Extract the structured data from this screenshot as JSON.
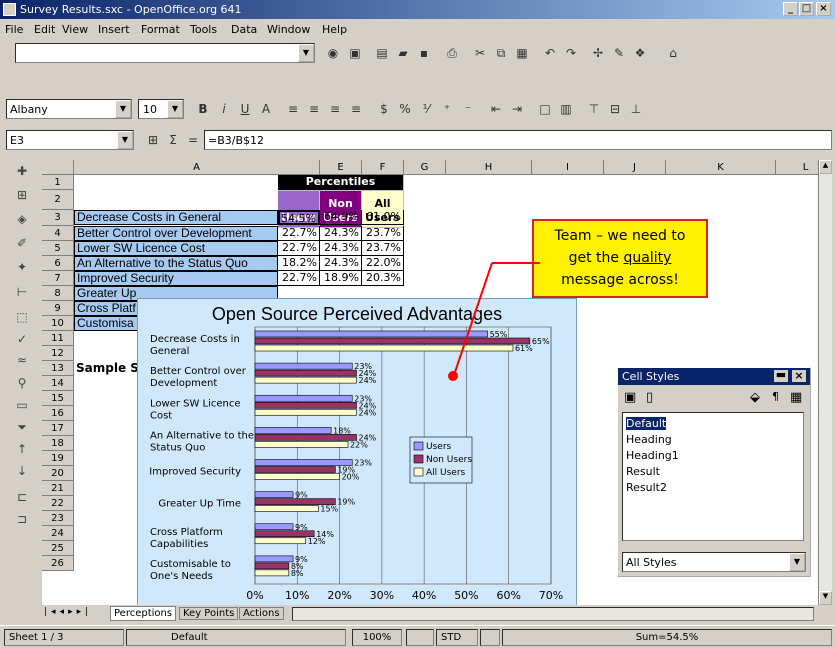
{
  "window": {
    "title": "Survey Results.sxc - OpenOffice.org 641"
  },
  "menu": [
    "File",
    "Edit",
    "View",
    "Insert",
    "Format",
    "Tools",
    "Data",
    "Window",
    "Help"
  ],
  "toolbar": {
    "font_name": "Albany",
    "font_size": "10",
    "cell_ref": "E3",
    "formula": "=B3/B$12",
    "sum_icon": "Σ",
    "equals": "="
  },
  "columns": [
    "A",
    "E",
    "F",
    "G",
    "H",
    "I",
    "J",
    "K",
    "L"
  ],
  "rows": [
    "1",
    "2",
    "3",
    "4",
    "5",
    "6",
    "7",
    "8",
    "9",
    "10",
    "11",
    "12",
    "13",
    "14",
    "15",
    "16",
    "17",
    "18",
    "19",
    "20",
    "21",
    "22",
    "23",
    "24",
    "25",
    "26"
  ],
  "sheet": {
    "percentiles_header": "Percentiles",
    "col_users": "Users",
    "col_non_users_1": "Non",
    "col_non_users_2": "Users",
    "col_all_users_1": "All",
    "col_all_users_2": "Users",
    "data_rows": [
      {
        "label": "Decrease Costs in General",
        "users": "54.5%",
        "non": "64.9%",
        "all": "61.0%"
      },
      {
        "label": "Better Control over Development",
        "users": "22.7%",
        "non": "24.3%",
        "all": "23.7%"
      },
      {
        "label": "Lower SW Licence Cost",
        "users": "22.7%",
        "non": "24.3%",
        "all": "23.7%"
      },
      {
        "label": "An Alternative to the Status Quo",
        "users": "18.2%",
        "non": "24.3%",
        "all": "22.0%"
      },
      {
        "label": "Improved Security",
        "users": "22.7%",
        "non": "18.9%",
        "all": "20.3%"
      },
      {
        "label": "Greater Up",
        "users": "",
        "non": "",
        "all": ""
      },
      {
        "label": "Cross Platf",
        "users": "",
        "non": "",
        "all": ""
      },
      {
        "label": "Customisa",
        "users": "",
        "non": "",
        "all": ""
      }
    ],
    "row12_label": "Sample Si"
  },
  "callout": {
    "line1": "Team – we need to",
    "line2a": "get the ",
    "line2b": "quality",
    "line3": "message across!"
  },
  "chart_data": {
    "type": "bar",
    "title": "Open Source Perceived Advantages",
    "categories": [
      "Decrease Costs in General",
      "Better Control over Development",
      "Lower SW Licence Cost",
      "An Alternative to the Status Quo",
      "Improved Security",
      "Greater Up Time",
      "Cross Platform Capabilities",
      "Customisable to One's Needs"
    ],
    "series": [
      {
        "name": "Users",
        "color": "#9999ff",
        "values": [
          55,
          23,
          23,
          18,
          23,
          9,
          9,
          9
        ]
      },
      {
        "name": "Non Users",
        "color": "#993366",
        "values": [
          65,
          24,
          24,
          24,
          19,
          19,
          14,
          8
        ]
      },
      {
        "name": "All Users",
        "color": "#ffffcc",
        "values": [
          61,
          24,
          24,
          22,
          20,
          15,
          12,
          8
        ]
      }
    ],
    "data_labels": [
      [
        "55%",
        "65%",
        "61%"
      ],
      [
        "23%",
        "24%",
        "24%"
      ],
      [
        "23%",
        "24%",
        "24%"
      ],
      [
        "18%",
        "24%",
        "22%"
      ],
      [
        "23%",
        "19%",
        "20%"
      ],
      [
        "9%",
        "19%",
        "15%"
      ],
      [
        "9%",
        "14%",
        "12%"
      ],
      [
        "9%",
        "8%",
        "8%"
      ]
    ],
    "x_ticks": [
      "0%",
      "10%",
      "20%",
      "30%",
      "40%",
      "50%",
      "60%",
      "70%"
    ],
    "xlim": [
      0,
      70
    ],
    "legend_position": "center-right",
    "grid": true
  },
  "stylist": {
    "title": "Cell Styles",
    "items": [
      "Default",
      "Heading",
      "Heading1",
      "Result",
      "Result2"
    ],
    "filter": "All Styles"
  },
  "tabs": [
    "Perceptions",
    "Key Points",
    "Actions"
  ],
  "status": {
    "sheet": "Sheet 1 / 3",
    "style": "Default",
    "zoom": "100%",
    "mode": "STD",
    "sum": "Sum=54.5%"
  }
}
